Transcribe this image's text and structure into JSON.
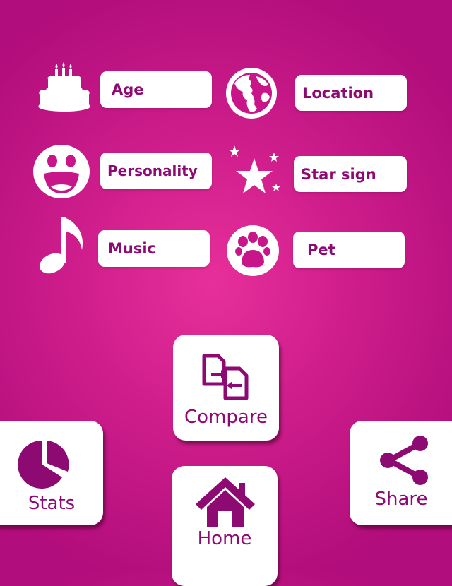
{
  "colors": {
    "accent": "#8e0a73",
    "background": "#c8168a",
    "tile": "#ffffff"
  },
  "categories": [
    {
      "label": "Age",
      "icon": "birthday-cake-icon"
    },
    {
      "label": "Location",
      "icon": "globe-icon"
    },
    {
      "label": "Personality",
      "icon": "smiley-face-icon"
    },
    {
      "label": "Star sign",
      "icon": "stars-icon"
    },
    {
      "label": "Music",
      "icon": "music-note-icon"
    },
    {
      "label": "Pet",
      "icon": "paw-icon"
    }
  ],
  "nav": {
    "compare": {
      "label": "Compare",
      "icon": "compare-documents-icon"
    },
    "stats": {
      "label": "Stats",
      "icon": "pie-chart-icon"
    },
    "share": {
      "label": "Share",
      "icon": "share-icon"
    },
    "home": {
      "label": "Home",
      "icon": "home-icon"
    }
  }
}
